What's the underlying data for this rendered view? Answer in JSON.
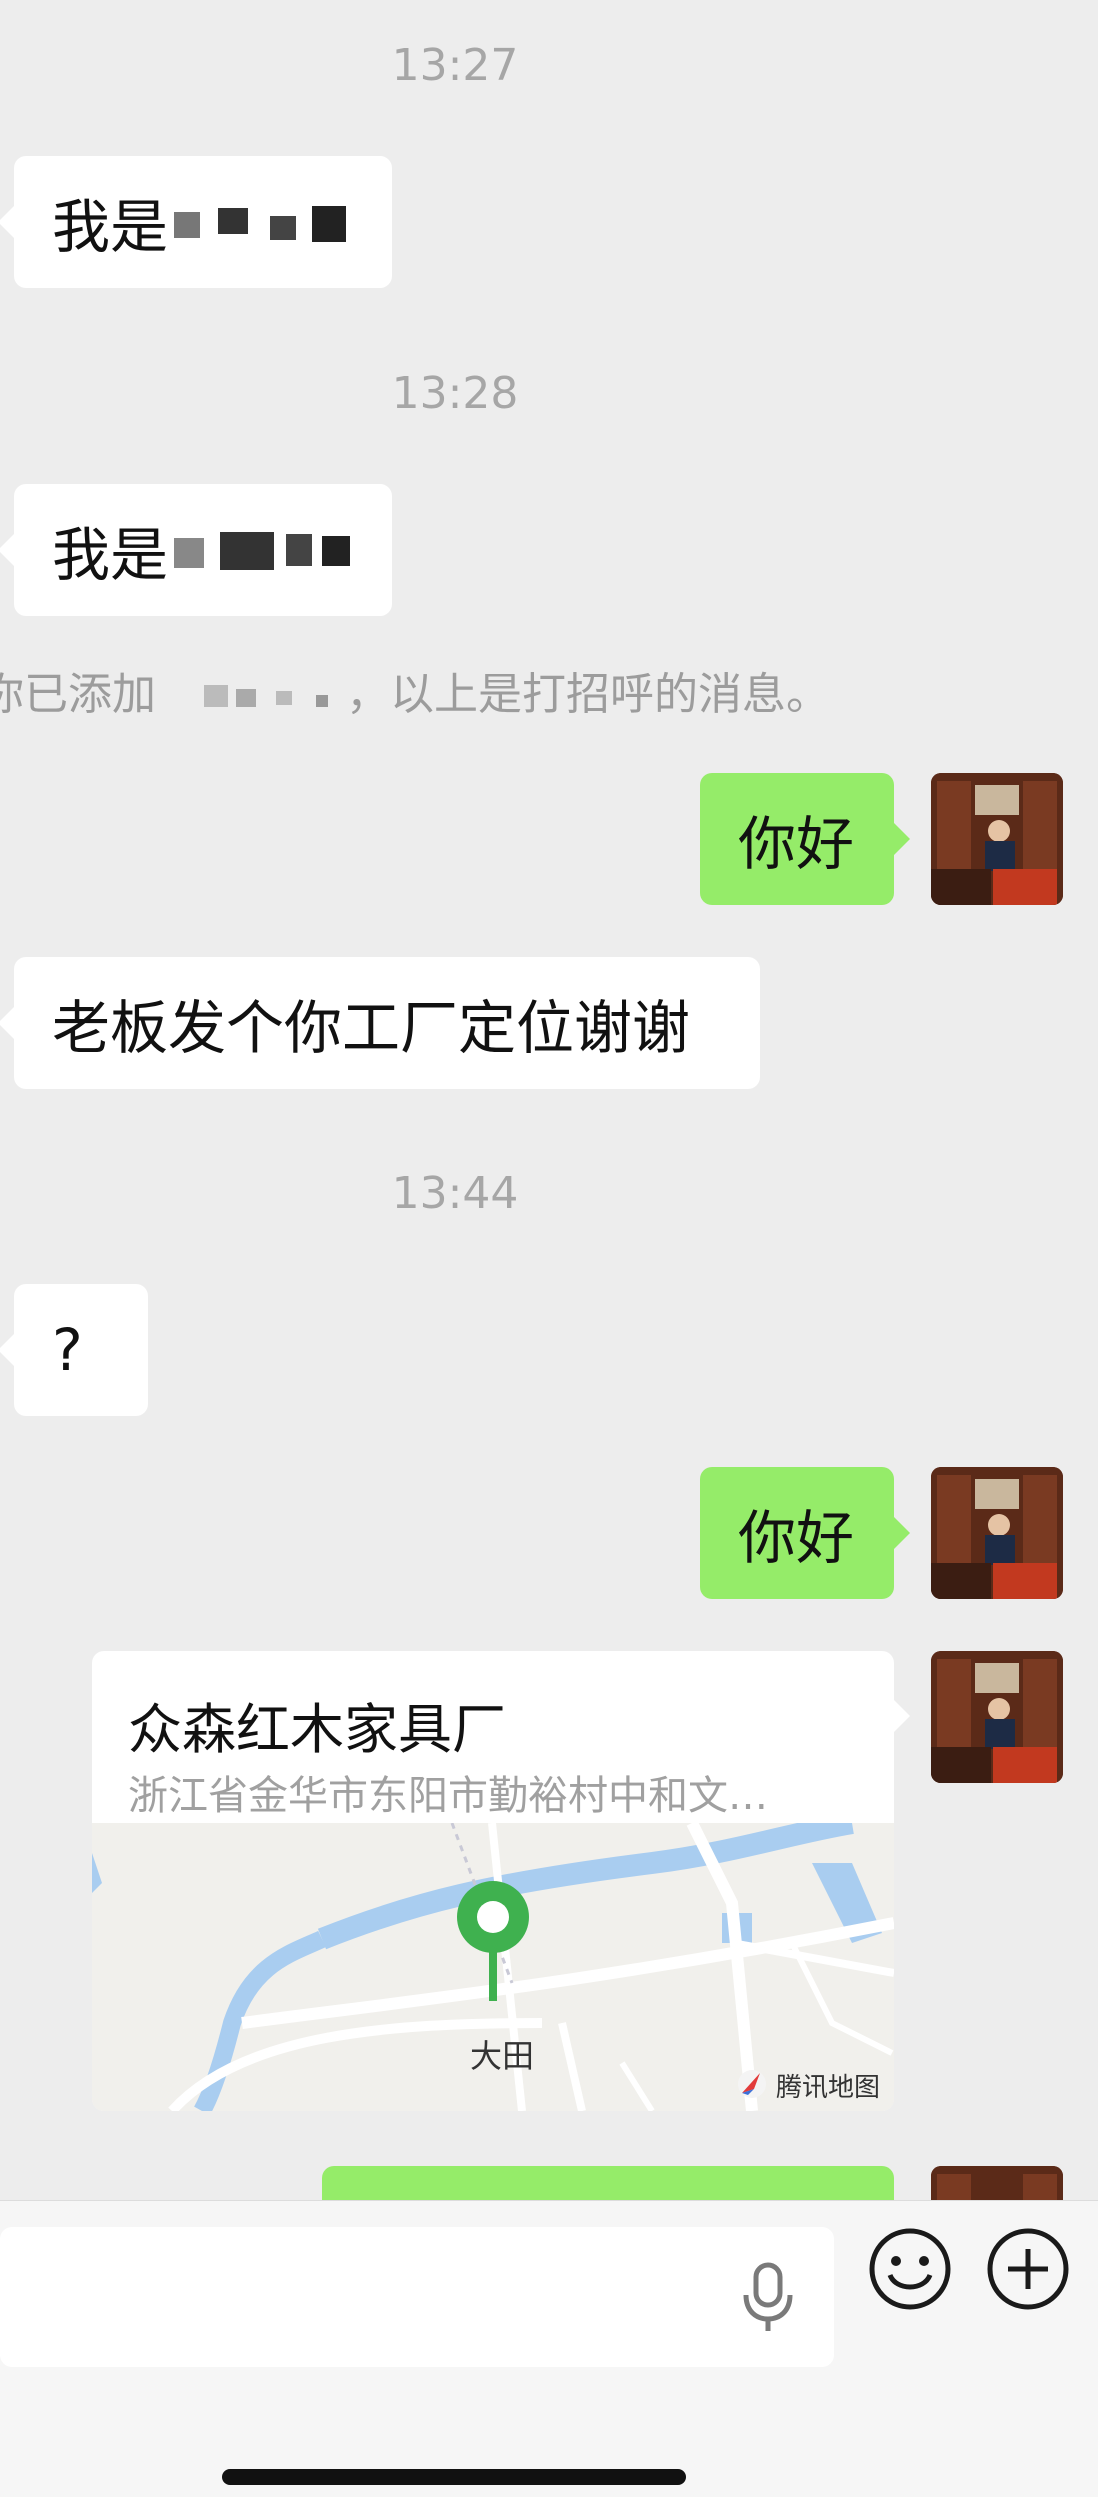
{
  "chat": {
    "timestamps": [
      "13:27",
      "13:28",
      "13:44"
    ],
    "messages": [
      {
        "side": "left",
        "text": "我是"
      },
      {
        "side": "left",
        "text": "我是"
      },
      {
        "side": "right",
        "text": "你好"
      },
      {
        "side": "left",
        "text": "老板发个你工厂定位谢谢"
      },
      {
        "side": "left",
        "text": "?"
      },
      {
        "side": "right",
        "text": "你好"
      }
    ],
    "system_notice": {
      "prefix": "你已添加",
      "suffix": "，以上是打招呼的消息。"
    },
    "location": {
      "title": "众森红木家具厂",
      "address": "浙江省金华市东阳市勤裕村中和文…",
      "map_label": "大田",
      "map_brand": "腾讯地图"
    }
  },
  "composer": {
    "voice_icon": "microphone-icon",
    "emoji_icon": "emoji-icon",
    "plus_icon": "plus-icon"
  },
  "colors": {
    "background": "#ededed",
    "sent_bubble": "#95ec69",
    "received_bubble": "#ffffff",
    "pin": "#3fb14f",
    "river": "#a9cdf0"
  }
}
